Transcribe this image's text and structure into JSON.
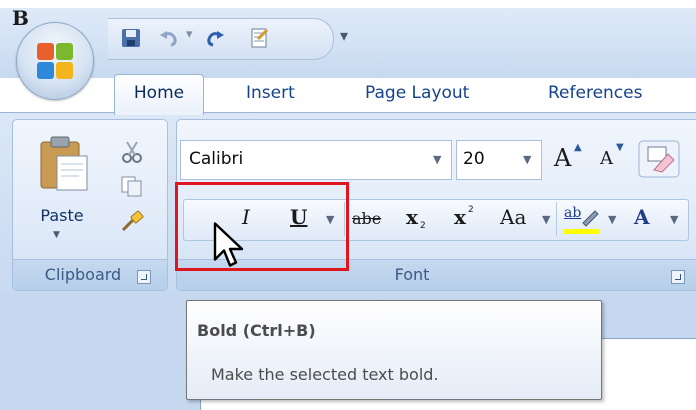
{
  "tabs": {
    "home": "Home",
    "insert": "Insert",
    "page_layout": "Page Layout",
    "references": "References"
  },
  "quick_access": {
    "icons": [
      "save-icon",
      "undo-icon",
      "redo-icon",
      "format-painter-icon"
    ]
  },
  "clipboard": {
    "paste_label": "Paste",
    "group_label": "Clipboard"
  },
  "font": {
    "group_label": "Font",
    "font_name": "Calibri",
    "font_size": "20",
    "bold_glyph": "B",
    "italic_glyph": "I",
    "underline_glyph": "U",
    "strike_glyph": "abe",
    "subscript_glyph": "x",
    "subscript_mark": "2",
    "superscript_glyph": "x",
    "superscript_mark": "2",
    "case_glyph": "Aa",
    "grow_glyph": "A",
    "shrink_glyph": "A",
    "highlight_glyph": "ab",
    "font_color_glyph": "A"
  },
  "tooltip": {
    "title": "Bold (Ctrl+B)",
    "body": "Make the selected text bold."
  },
  "colors": {
    "accent": "#15428b",
    "highlight_border": "#e0161f",
    "bold_active": "#ffd97a"
  }
}
